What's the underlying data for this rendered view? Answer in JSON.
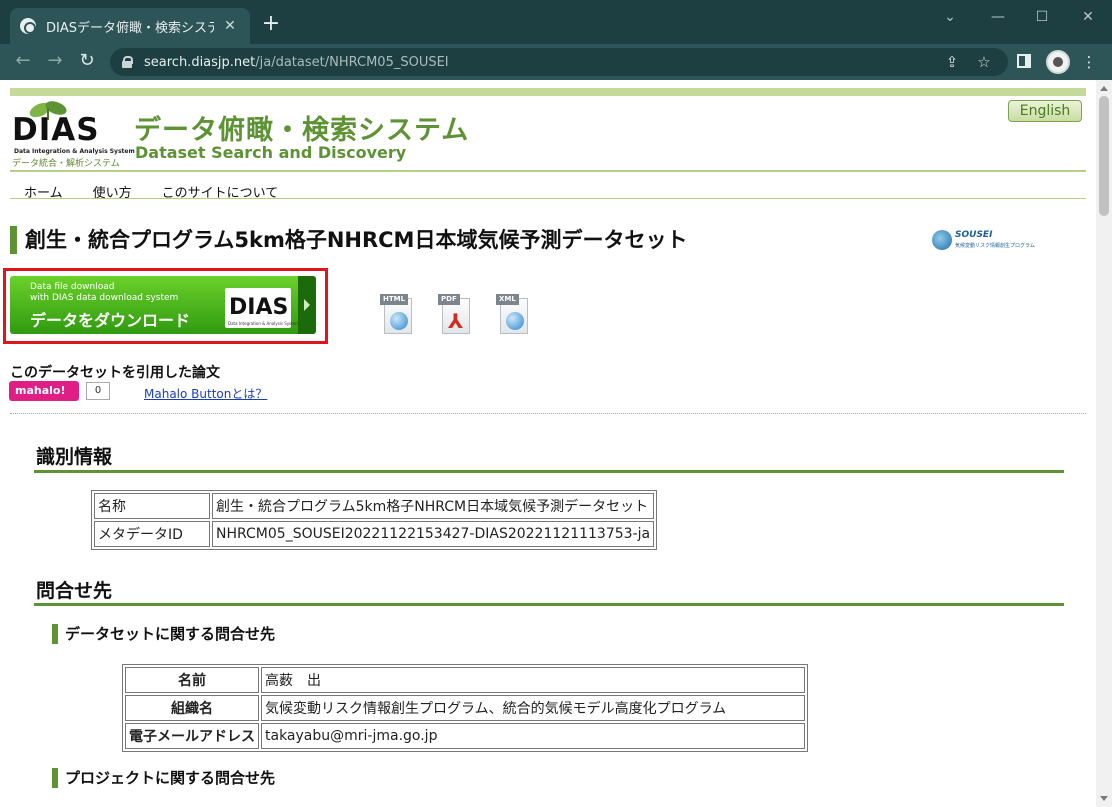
{
  "browser": {
    "tab_title": "DIASデータ俯瞰・検索システム",
    "tab_close": "✕",
    "new_tab": "+",
    "url_host": "search.diasjp.net",
    "url_path": "/ja/dataset/NHRCM05_SOUSEI",
    "window_controls": {
      "minimize": "—",
      "maximize": "☐",
      "close": "✕"
    }
  },
  "header": {
    "logo_text": "DIAS",
    "logo_sub_en": "Data Integration & Analysis System",
    "logo_sub_ja": "データ統合・解析システム",
    "title_ja": "データ俯瞰・検索システム",
    "title_en": "Dataset Search and Discovery",
    "language_button": "English"
  },
  "nav": {
    "items": [
      {
        "label": "ホーム"
      },
      {
        "label": "使い方"
      },
      {
        "label": "このサイトについて"
      }
    ]
  },
  "dataset": {
    "title": "創生・統合プログラム5km格子NHRCM日本域気候予測データセット",
    "sousei_logo": "SOUSEI",
    "sousei_sub": "気候変動リスク情報創生プログラム"
  },
  "download": {
    "small_line1": "Data file download",
    "small_line2": "with DIAS data download system",
    "main_label": "データをダウンロード",
    "logo_text": "DIAS",
    "logo_sub": "Data Integration & Analysis System"
  },
  "formats": [
    {
      "tag": "HTML"
    },
    {
      "tag": "PDF"
    },
    {
      "tag": "XML"
    }
  ],
  "citations": {
    "title": "このデータセットを引用した論文",
    "mahalo_label": "mahalo!",
    "mahalo_count": "0",
    "mahalo_link": "Mahalo Buttonとは？"
  },
  "identification": {
    "heading": "識別情報",
    "rows": [
      {
        "label": "名称",
        "value": "創生・統合プログラム5km格子NHRCM日本域気候予測データセット"
      },
      {
        "label": "メタデータID",
        "value": "NHRCM05_SOUSEI20221122153427-DIAS20221121113753-ja"
      }
    ]
  },
  "contact": {
    "heading": "問合せ先",
    "dataset_contact_heading": "データセットに関する問合せ先",
    "rows": [
      {
        "label": "名前",
        "value": "高薮　出"
      },
      {
        "label": "組織名",
        "value": "気候変動リスク情報創生プログラム、統合的気候モデル高度化プログラム"
      },
      {
        "label": "電子メールアドレス",
        "value": "takayabu@mri-jma.go.jp"
      }
    ],
    "project_contact_heading": "プロジェクトに関する問合せ先"
  }
}
